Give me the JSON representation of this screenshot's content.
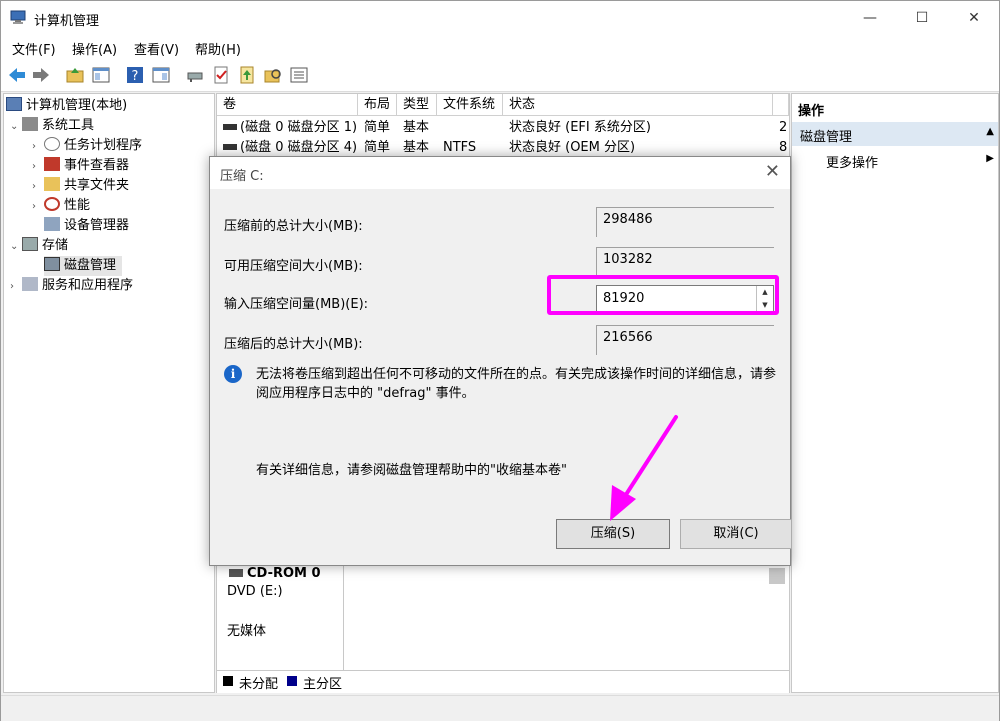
{
  "window": {
    "title": "计算机管理",
    "minimize": "—",
    "maximize": "☐",
    "close": "✕"
  },
  "menu": [
    "文件(F)",
    "操作(A)",
    "查看(V)",
    "帮助(H)"
  ],
  "tree": {
    "root": "计算机管理(本地)",
    "system_tools": "系统工具",
    "task_scheduler": "任务计划程序",
    "event_viewer": "事件查看器",
    "shared_folders": "共享文件夹",
    "performance": "性能",
    "device_manager": "设备管理器",
    "storage": "存储",
    "disk_management": "磁盘管理",
    "services_apps": "服务和应用程序"
  },
  "volume_list": {
    "headers": [
      "卷",
      "布局",
      "类型",
      "文件系统",
      "状态"
    ],
    "rows": [
      {
        "volume": "(磁盘 0 磁盘分区 1)",
        "layout": "简单",
        "type": "基本",
        "fs": "",
        "status": "状态良好 (EFI 系统分区)",
        "extra": "2"
      },
      {
        "volume": "(磁盘 0 磁盘分区 4)",
        "layout": "简单",
        "type": "基本",
        "fs": "NTFS",
        "status": "状态良好 (OEM 分区)",
        "extra": "8"
      }
    ]
  },
  "cdrom": {
    "name": "CD-ROM 0",
    "drive": "DVD (E:)",
    "media": "无媒体"
  },
  "legend": {
    "unallocated": "未分配",
    "primary": "主分区"
  },
  "actions_pane": {
    "header": "操作",
    "section": "磁盘管理",
    "more": "更多操作"
  },
  "dialog": {
    "title": "压缩 C:",
    "total_before_label": "压缩前的总计大小(MB):",
    "total_before_value": "298486",
    "available_label": "可用压缩空间大小(MB):",
    "available_value": "103282",
    "input_label": "输入压缩空间量(MB)(E):",
    "input_value": "81920",
    "total_after_label": "压缩后的总计大小(MB):",
    "total_after_value": "216566",
    "info_text": "无法将卷压缩到超出任何不可移动的文件所在的点。有关完成该操作时间的详细信息，请参阅应用程序日志中的 \"defrag\" 事件。",
    "help_text": "有关详细信息，请参阅磁盘管理帮助中的\"收缩基本卷\"",
    "shrink_button": "压缩(S)",
    "cancel_button": "取消(C)"
  },
  "colors": {
    "highlight": "#ff00ff",
    "info_icon": "#1a66c8"
  }
}
